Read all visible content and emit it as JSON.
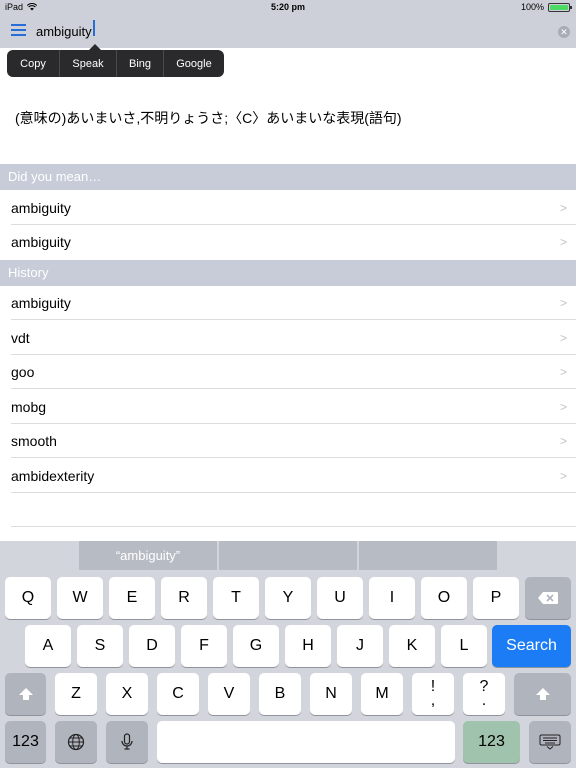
{
  "status_bar": {
    "device": "iPad",
    "time": "5:20 pm",
    "battery_pct": "100%",
    "battery_level": 1.0
  },
  "search": {
    "value": "ambiguity"
  },
  "edit_menu": {
    "items": [
      "Copy",
      "Speak",
      "Bing",
      "Google"
    ]
  },
  "definition": {
    "text": "(意味の)あいまいさ,不明りょうさ;〈C〉あいまいな表現(語句)"
  },
  "suggestions": {
    "header": "Did you mean…",
    "items": [
      "ambiguity",
      "ambiguity"
    ]
  },
  "history": {
    "header": "History",
    "items": [
      "ambiguity",
      "vdt",
      "goo",
      "mobg",
      "smooth",
      "ambidexterity"
    ]
  },
  "predictive": {
    "items": [
      "“ambiguity”",
      "",
      ""
    ]
  },
  "keyboard": {
    "row1": [
      "Q",
      "W",
      "E",
      "R",
      "T",
      "Y",
      "U",
      "I",
      "O",
      "P"
    ],
    "row2": [
      "A",
      "S",
      "D",
      "F",
      "G",
      "H",
      "J",
      "K",
      "L"
    ],
    "row3": [
      "Z",
      "X",
      "C",
      "V",
      "B",
      "N",
      "M"
    ],
    "punct": [
      "!",
      ",",
      "?",
      "."
    ],
    "search_label": "Search",
    "numbers_label": "123",
    "icons": {
      "backspace": "backspace-icon",
      "shift": "shift-icon",
      "globe": "globe-icon",
      "mic": "microphone-icon",
      "hide": "keyboard-hide-icon"
    }
  },
  "colors": {
    "accent": "#2a6cd6",
    "search_key": "#1b7cf6",
    "header_bg": "#c7ccd8"
  }
}
